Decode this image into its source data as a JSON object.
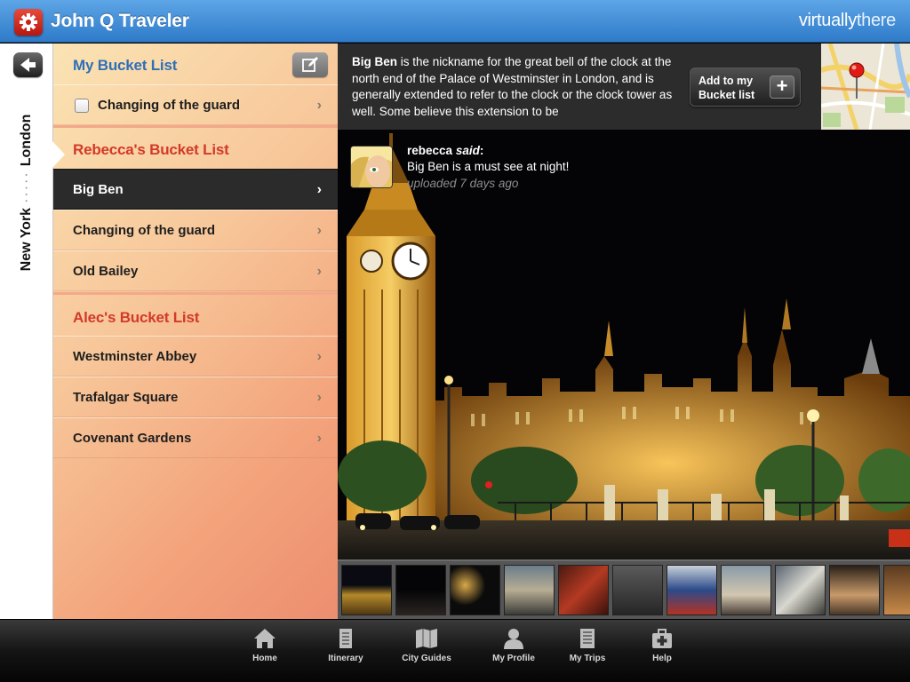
{
  "header": {
    "app_title": "John Q Traveler",
    "brand_part1": "virtually",
    "brand_part2": "there",
    "brand_color": "#2f7bc9",
    "icon": "gear-icon"
  },
  "location": {
    "from": "New York",
    "separator": "·····",
    "to": "London",
    "back_icon": "back-arrow-icon"
  },
  "bucket": {
    "my": {
      "title": "My Bucket List",
      "title_color": "#2f6fb8",
      "edit_icon": "compose-icon",
      "items": [
        {
          "label": "Changing of the guard",
          "checked": false
        }
      ]
    },
    "rebecca": {
      "title": "Rebecca's Bucket List",
      "title_color": "#d23a2a",
      "items": [
        {
          "label": "Big Ben",
          "selected": true
        },
        {
          "label": "Changing of the guard"
        },
        {
          "label": "Old Bailey"
        }
      ]
    },
    "alec": {
      "title": "Alec's Bucket List",
      "title_color": "#d23a2a",
      "items": [
        {
          "label": "Westminster Abbey"
        },
        {
          "label": "Trafalgar Square"
        },
        {
          "label": "Covenant Gardens"
        }
      ]
    },
    "chevron": "›"
  },
  "info": {
    "subject": "Big Ben",
    "description": " is the nickname for the great bell of the clock at the north end of the Palace of Westminster in London, and is generally extended to refer to the clock or the clock tower as well. Some believe this extension to be",
    "add_button": "Add to my Bucket list",
    "add_icon": "plus-icon",
    "map_icon": "map-pin-icon"
  },
  "comment": {
    "user": "rebecca",
    "verb": "said",
    "colon": ":",
    "text": "Big Ben is a must see at night!",
    "time": "uploaded 7 days ago"
  },
  "tabs": [
    {
      "label": "Home",
      "icon": "home-icon"
    },
    {
      "label": "Itinerary",
      "icon": "itinerary-icon"
    },
    {
      "label": "City Guides",
      "icon": "city-guides-icon"
    },
    {
      "label": "My Profile",
      "icon": "profile-icon"
    },
    {
      "label": "My Trips",
      "icon": "trips-icon"
    },
    {
      "label": "Help",
      "icon": "help-icon"
    }
  ]
}
